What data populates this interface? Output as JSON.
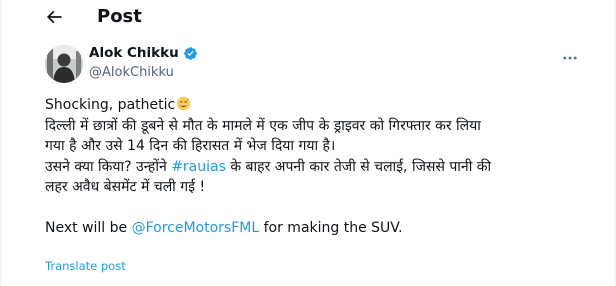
{
  "header": {
    "title": "Post"
  },
  "author": {
    "display_name": "Alok Chikku",
    "handle": "@AlokChikku"
  },
  "tweet": {
    "line1": "Shocking, pathetic",
    "line2": "दिल्ली में छात्रों की डूबने से मौत के मामले में एक जीप के ड्राइवर को गिरफ्तार कर लिया",
    "line3": "गया है और उसे 14 दिन की हिरासत में भेज दिया गया है।",
    "line4_pre": "उसने क्या किया? उन्होंने ",
    "line4_hashtag": "#rauias",
    "line4_post": " के बाहर अपनी कार तेजी से चलाई, जिससे पानी की",
    "line5": "लहर अवैध बेसमेंट में चली गई !",
    "line6_pre": "Next will be ",
    "line6_mention": "@ForceMotorsFML",
    "line6_post": " for making the SUV."
  },
  "translate_label": "Translate post",
  "icons": {
    "back": "arrow-left-icon",
    "verified": "verified-badge-icon",
    "more": "more-options-icon",
    "emoji": "grinning-face-with-sweat-emoji"
  },
  "colors": {
    "link": "#1d9bf0",
    "text": "#0f1419",
    "muted": "#536471"
  }
}
